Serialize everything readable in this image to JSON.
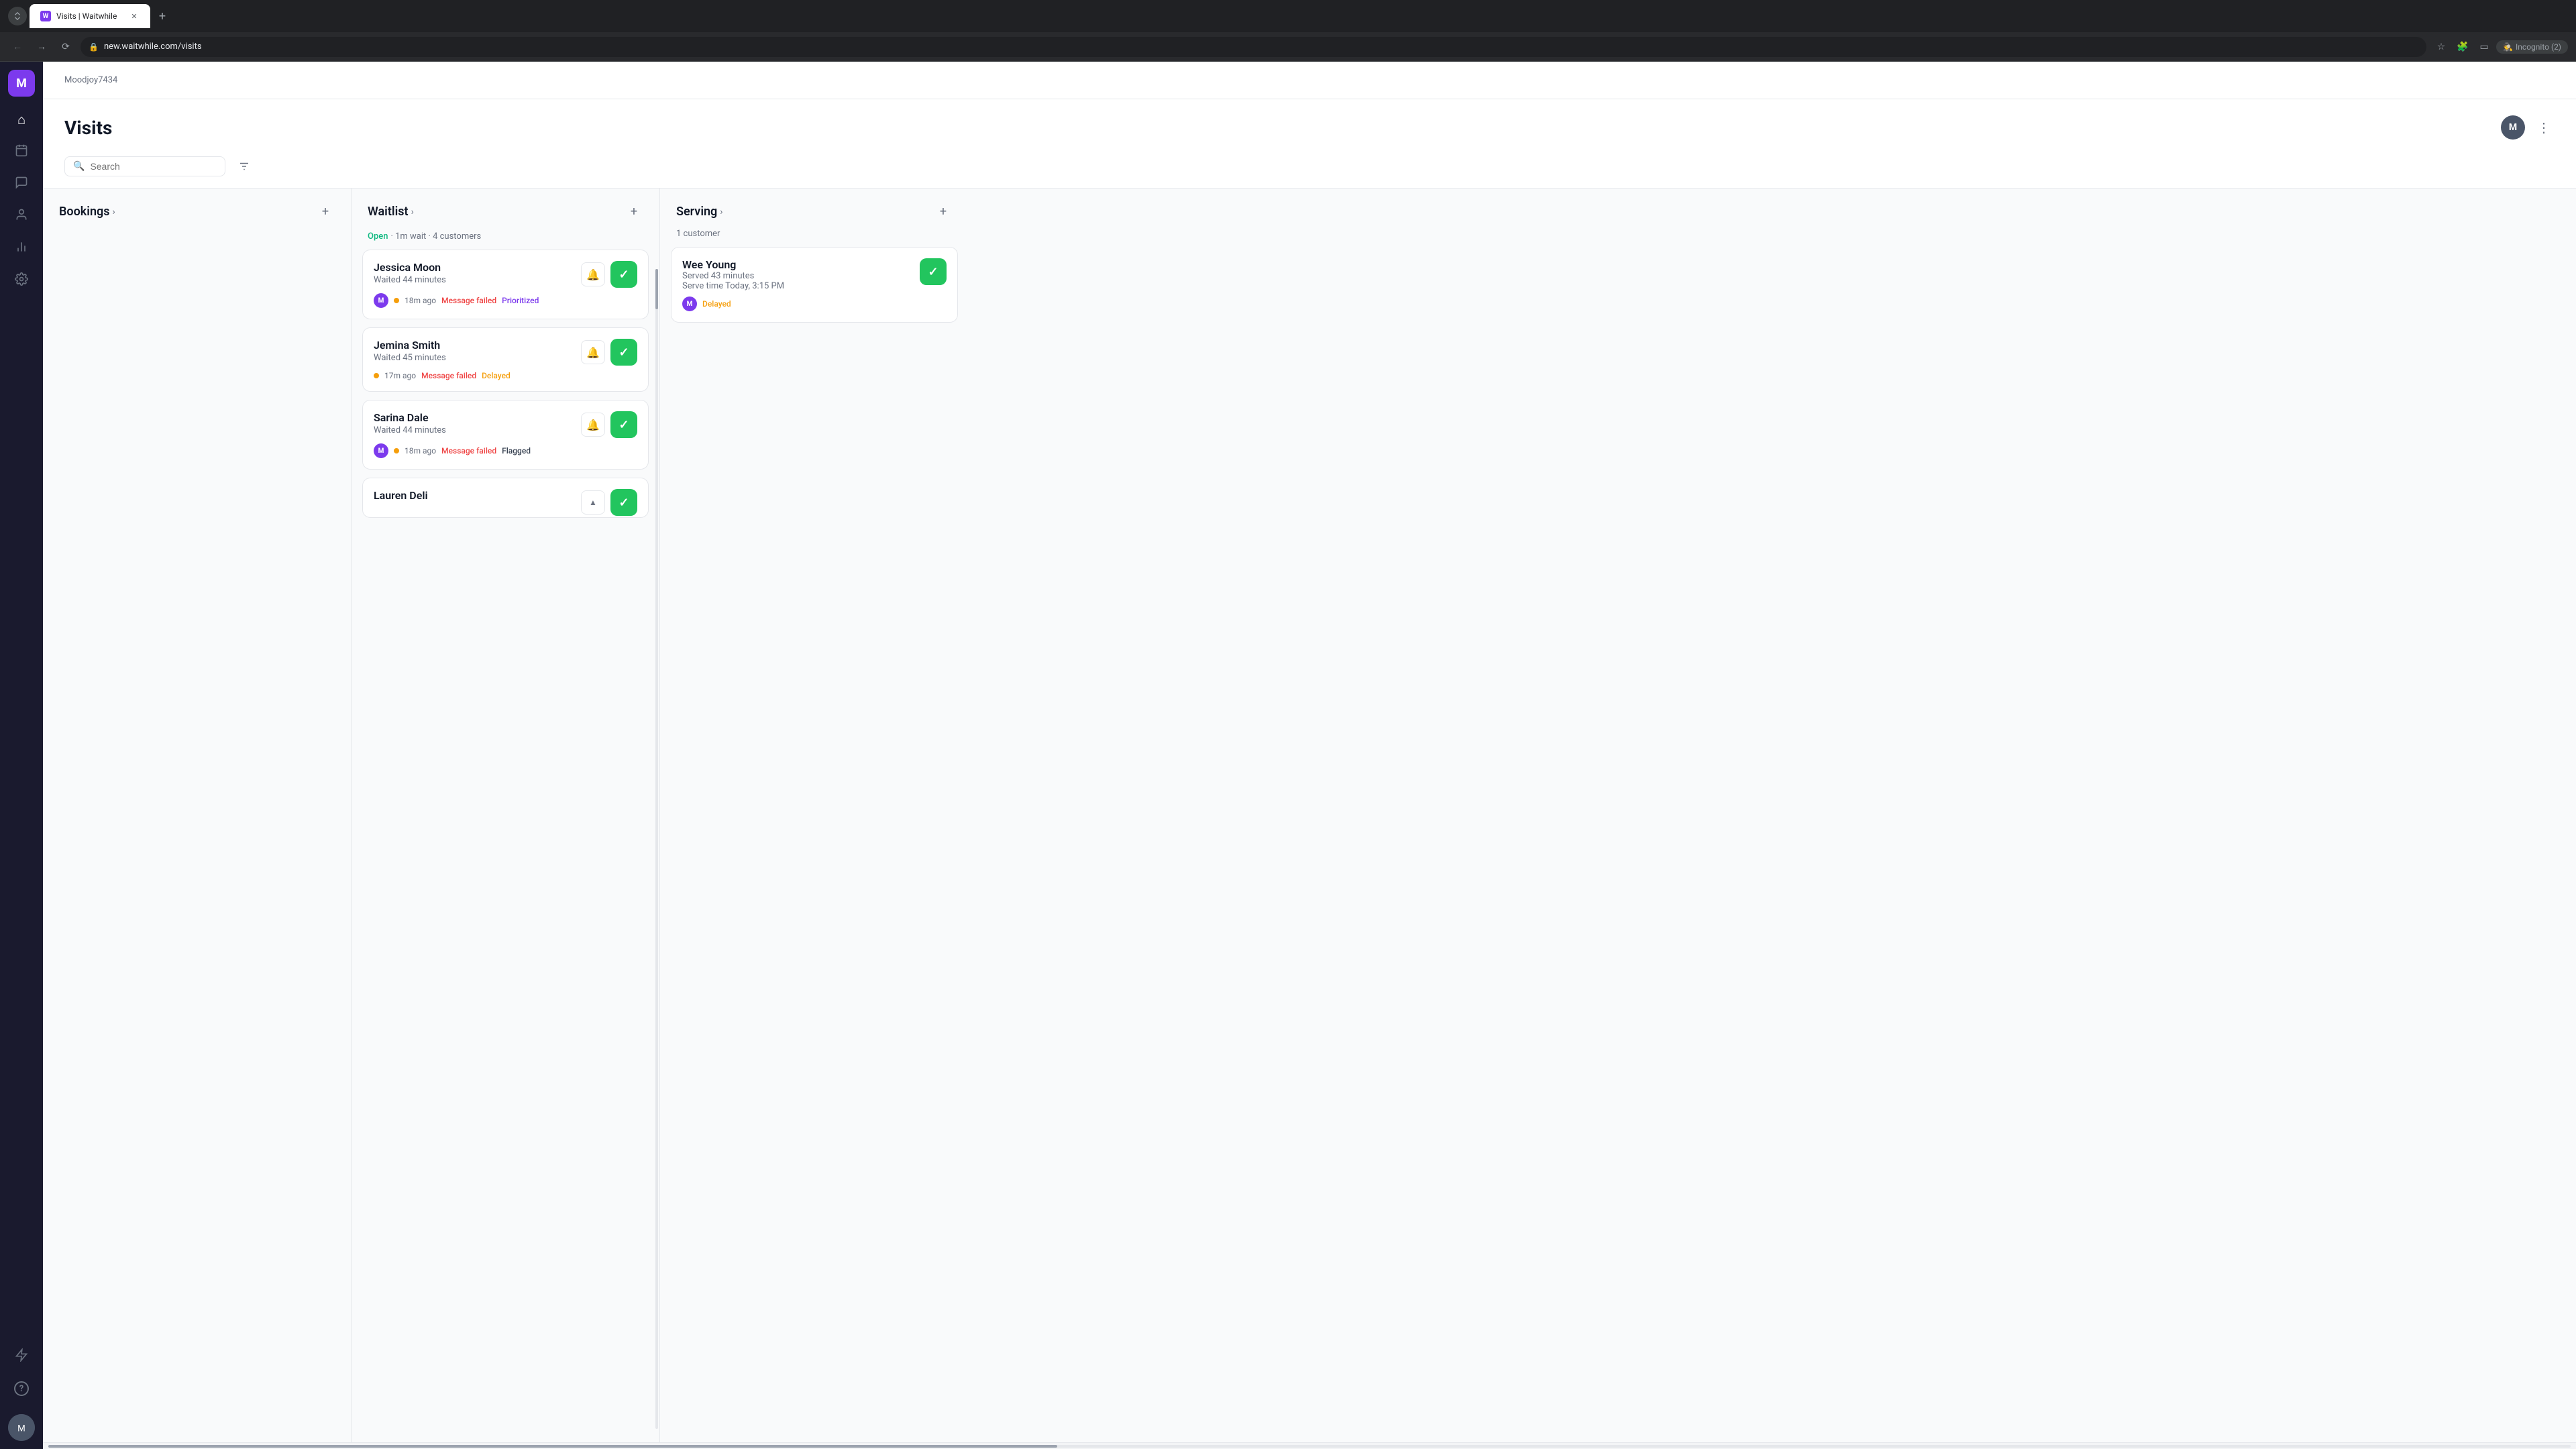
{
  "browser": {
    "tab_title": "Visits | Waitwhile",
    "url": "new.waitwhile.com/visits",
    "tab_favicon_letter": "W",
    "incognito_label": "Incognito (2)"
  },
  "sidebar": {
    "logo_letter": "M",
    "items": [
      {
        "id": "home",
        "icon": "⌂",
        "label": "Home"
      },
      {
        "id": "calendar",
        "icon": "▦",
        "label": "Calendar"
      },
      {
        "id": "chat",
        "icon": "💬",
        "label": "Messages"
      },
      {
        "id": "users",
        "icon": "👤",
        "label": "Users"
      },
      {
        "id": "analytics",
        "icon": "📊",
        "label": "Analytics"
      },
      {
        "id": "settings",
        "icon": "⚙",
        "label": "Settings"
      }
    ],
    "bottom_items": [
      {
        "id": "lightning",
        "icon": "⚡",
        "label": "Quick actions"
      },
      {
        "id": "help",
        "icon": "?",
        "label": "Help"
      }
    ],
    "avatar_letter": "M"
  },
  "topbar": {
    "org_name": "Moodjoy7434"
  },
  "page": {
    "title": "Visits",
    "search_placeholder": "Search",
    "user_avatar_letter": "M"
  },
  "columns": {
    "bookings": {
      "title": "Bookings",
      "add_label": "+"
    },
    "waitlist": {
      "title": "Waitlist",
      "add_label": "+",
      "status_open": "Open",
      "status_details": "· 1m wait · 4 customers",
      "customers": [
        {
          "name": "Jessica Moon",
          "waited": "Waited 44 minutes",
          "avatar_letter": "M",
          "time": "18m ago",
          "message_status": "Message failed",
          "tag": "Prioritized",
          "tag_type": "prioritized"
        },
        {
          "name": "Jemina Smith",
          "waited": "Waited 45 minutes",
          "avatar_letter": null,
          "time": "17m ago",
          "message_status": "Message failed",
          "tag": "Delayed",
          "tag_type": "delayed"
        },
        {
          "name": "Sarina Dale",
          "waited": "Waited 44 minutes",
          "avatar_letter": "M",
          "time": "18m ago",
          "message_status": "Message failed",
          "tag": "Flagged",
          "tag_type": "flagged"
        },
        {
          "name": "Lauren Deli",
          "waited": "",
          "avatar_letter": null,
          "time": "",
          "message_status": "",
          "tag": "",
          "tag_type": "",
          "partial": true
        }
      ]
    },
    "serving": {
      "title": "Serving",
      "add_label": "+",
      "customer_count": "1 customer",
      "customers": [
        {
          "name": "Wee Young",
          "served_time": "Served 43 minutes",
          "serve_time": "Serve time Today, 3:15 PM",
          "avatar_letter": "M",
          "tag": "Delayed",
          "tag_type": "delayed"
        }
      ]
    }
  }
}
